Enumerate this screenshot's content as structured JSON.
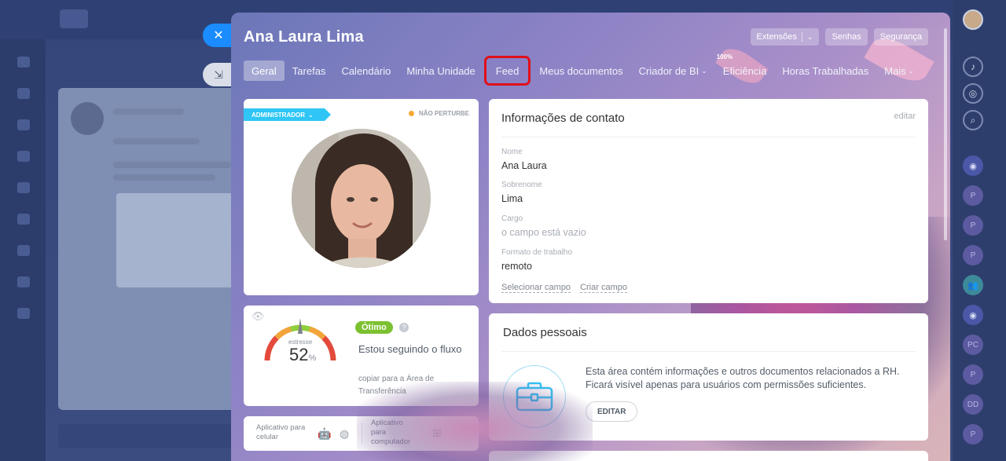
{
  "profile": {
    "name": "Ana Laura Lima"
  },
  "header_buttons": {
    "extensions": "Extensões",
    "passwords": "Senhas",
    "security": "Segurança"
  },
  "tabs": [
    {
      "label": "Geral",
      "active": true
    },
    {
      "label": "Tarefas"
    },
    {
      "label": "Calendário"
    },
    {
      "label": "Minha Unidade"
    },
    {
      "label": "Feed",
      "highlighted": true
    },
    {
      "label": "Meus documentos"
    },
    {
      "label": "Criador de BI"
    },
    {
      "label": "Eficiência",
      "badge": "100%"
    },
    {
      "label": "Horas Trabalhadas"
    },
    {
      "label": "Mais"
    }
  ],
  "photo_card": {
    "role_tag": "ADMINISTRADOR",
    "status": "NÃO PERTURBE"
  },
  "stress": {
    "label": "estresse",
    "value": "52",
    "unit": "%",
    "level_badge": "Ótimo",
    "status_text": "Estou seguindo o fluxo",
    "copy_link": "copiar para a Área de Transferência"
  },
  "apps": {
    "mobile_label": "Aplicativo para celular",
    "desktop_label": "Aplicativo para computador"
  },
  "contact": {
    "title": "Informações de contato",
    "edit": "editar",
    "fields": [
      {
        "label": "Nome",
        "value": "Ana Laura"
      },
      {
        "label": "Sobrenome",
        "value": "Lima"
      },
      {
        "label": "Cargo",
        "value": "o campo está vazio"
      },
      {
        "label": "Formato de trabalho",
        "value": "remoto"
      }
    ],
    "select_field": "Selecionar campo",
    "create_field": "Criar campo"
  },
  "personal": {
    "title": "Dados pessoais",
    "text_line1": "Esta área contém informações e outros documentos relacionados a RH.",
    "text_line2": "Ficará visível apenas para usuários com permissões suficientes.",
    "edit_button": "EDITAR"
  },
  "right_sidebar": {
    "items": [
      {
        "initials": "P"
      },
      {
        "initials": "P"
      },
      {
        "initials": "P"
      },
      {
        "initials": "PC"
      },
      {
        "initials": "P"
      },
      {
        "initials": "DD"
      },
      {
        "initials": "P"
      }
    ]
  },
  "colors": {
    "accent_blue": "#2fc6f6",
    "highlight_red": "#e0101a",
    "badge_green": "#7cc12f",
    "close_button": "#1a8cff"
  }
}
